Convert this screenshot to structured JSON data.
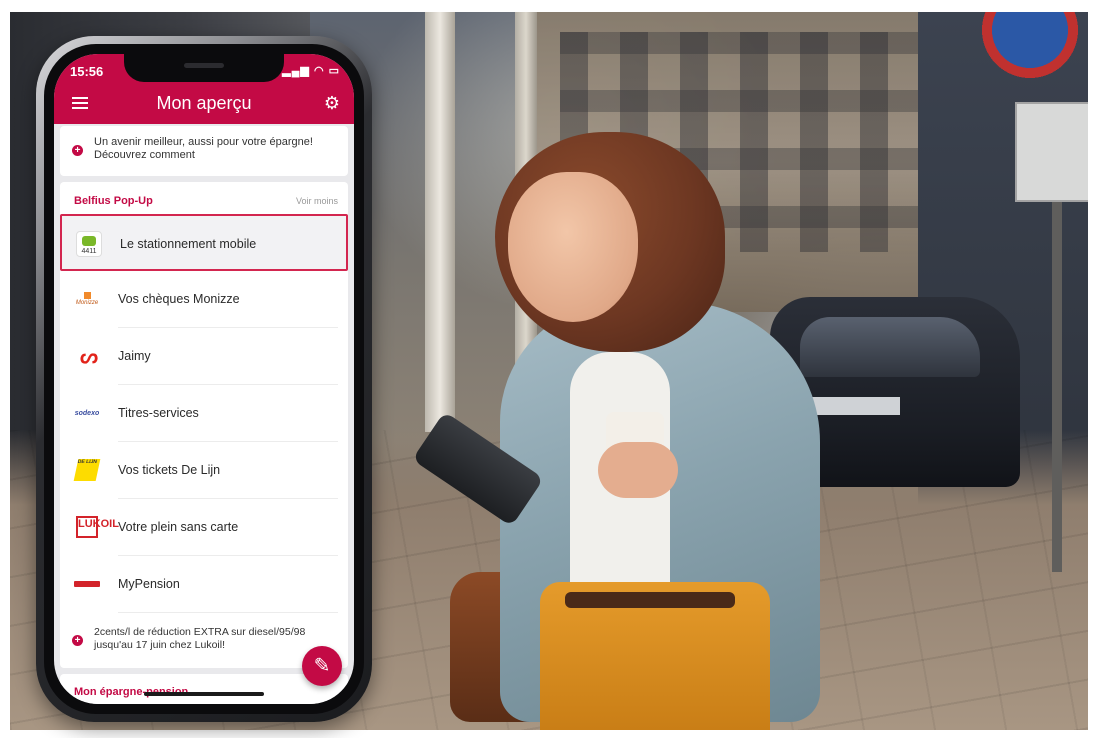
{
  "statusbar": {
    "time": "15:56",
    "icons": "▂▄▆ ◠ ▭"
  },
  "appbar": {
    "title": "Mon aperçu"
  },
  "promo_top": {
    "line1": "Un avenir meilleur, aussi pour votre épargne!",
    "line2": "Découvrez comment"
  },
  "popup": {
    "title": "Belfius Pop-Up",
    "toggle": "Voir moins",
    "items": [
      {
        "label": "Le stationnement mobile",
        "logo_text": "4411",
        "selected": true
      },
      {
        "label": "Vos chèques Monizze",
        "logo_text": "Monizze"
      },
      {
        "label": "Jaimy",
        "logo_text": "ᔕ"
      },
      {
        "label": "Titres-services",
        "logo_text": "sodexo"
      },
      {
        "label": "Vos tickets De Lijn",
        "logo_text": "DE LIJN"
      },
      {
        "label": "Votre plein sans carte",
        "logo_text": "LUKOIL"
      },
      {
        "label": "MyPension",
        "logo_text": ""
      }
    ],
    "bottom_promo": {
      "line1": "2cents/l de réduction EXTRA sur diesel/95/98",
      "line2": "jusqu'au 17 juin chez Lukoil!"
    }
  },
  "section": {
    "title": "Mon épargne-pension"
  },
  "colors": {
    "brand": "#c30a45",
    "selection_border": "#d3264f"
  },
  "icons": {
    "menu": "hamburger-icon",
    "settings": "gear-icon",
    "fab": "pencil-icon",
    "promo": "plus-circle-icon"
  }
}
